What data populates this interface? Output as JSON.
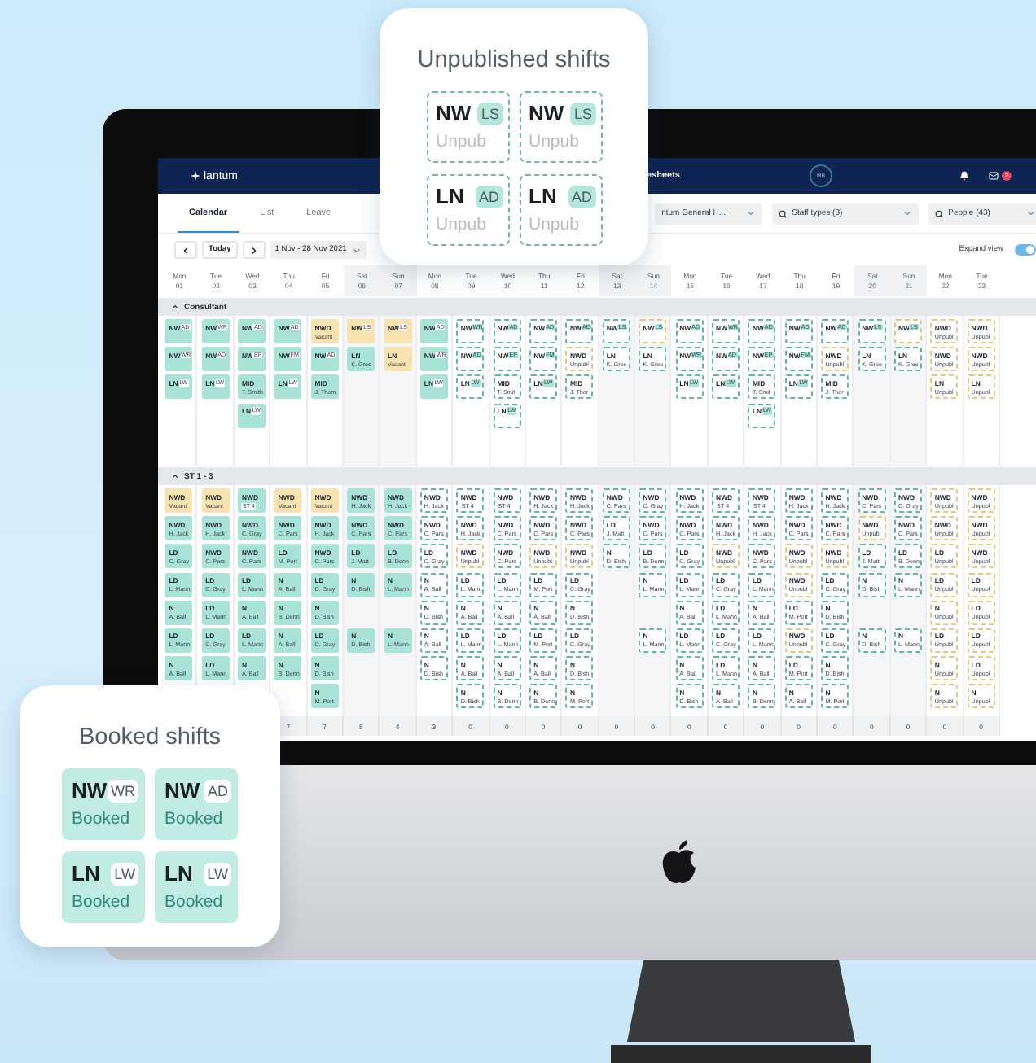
{
  "cards": [
    {
      "title": "Unpublished shifts",
      "shifts": [
        {
          "code": "NW",
          "tag": "LS",
          "status": "Unpub",
          "kind": "unpublished"
        },
        {
          "code": "NW",
          "tag": "LS",
          "status": "Unpub",
          "kind": "unpublished"
        },
        {
          "code": "LN",
          "tag": "AD",
          "status": "Unpub",
          "kind": "unpublished"
        },
        {
          "code": "LN",
          "tag": "AD",
          "status": "Unpub",
          "kind": "unpublished"
        }
      ]
    },
    {
      "title": "Booked shifts",
      "shifts": [
        {
          "code": "NW",
          "tag": "WR",
          "status": "Booked",
          "kind": "booked"
        },
        {
          "code": "NW",
          "tag": "AD",
          "status": "Booked",
          "kind": "booked"
        },
        {
          "code": "LN",
          "tag": "LW",
          "status": "Booked",
          "kind": "booked"
        },
        {
          "code": "LN",
          "tag": "LW",
          "status": "Booked",
          "kind": "booked"
        }
      ]
    }
  ],
  "app": {
    "logo": "lantum",
    "nav": [
      {
        "label": "esheets"
      }
    ],
    "avatar": "MB",
    "mail_count": "2",
    "tabs": [
      {
        "label": "Calendar",
        "selected": true
      },
      {
        "label": "List",
        "selected": false
      },
      {
        "label": "Leave",
        "selected": false
      }
    ],
    "filters": [
      {
        "label": "ntum General H...",
        "search": false
      },
      {
        "label": "Staff types (3)",
        "search": true
      },
      {
        "label": "People (43)",
        "search": true
      }
    ],
    "today": "Today",
    "date_range": "1 Nov - 28 Nov 2021",
    "expand_view": {
      "label": "Expand view",
      "on": true
    }
  },
  "days": [
    {
      "day": "Mon",
      "date": "01",
      "weekend": false
    },
    {
      "day": "Tue",
      "date": "02",
      "weekend": false
    },
    {
      "day": "Wed",
      "date": "03",
      "weekend": false
    },
    {
      "day": "Thu",
      "date": "04",
      "weekend": false
    },
    {
      "day": "Fri",
      "date": "05",
      "weekend": false
    },
    {
      "day": "Sat",
      "date": "06",
      "weekend": true
    },
    {
      "day": "Sun",
      "date": "07",
      "weekend": true
    },
    {
      "day": "Mon",
      "date": "08",
      "weekend": false
    },
    {
      "day": "Tue",
      "date": "09",
      "weekend": false
    },
    {
      "day": "Wed",
      "date": "10",
      "weekend": false
    },
    {
      "day": "Thu",
      "date": "11",
      "weekend": false
    },
    {
      "day": "Fri",
      "date": "12",
      "weekend": false
    },
    {
      "day": "Sat",
      "date": "13",
      "weekend": true
    },
    {
      "day": "Sun",
      "date": "14",
      "weekend": true
    },
    {
      "day": "Mon",
      "date": "15",
      "weekend": false
    },
    {
      "day": "Tue",
      "date": "16",
      "weekend": false
    },
    {
      "day": "Wed",
      "date": "17",
      "weekend": false
    },
    {
      "day": "Thu",
      "date": "18",
      "weekend": false
    },
    {
      "day": "Fri",
      "date": "19",
      "weekend": false
    },
    {
      "day": "Sat",
      "date": "20",
      "weekend": true
    },
    {
      "day": "Sun",
      "date": "21",
      "weekend": true
    },
    {
      "day": "Mon",
      "date": "22",
      "weekend": false
    },
    {
      "day": "Tue",
      "date": "23",
      "weekend": false
    }
  ],
  "sections": [
    {
      "title": "Consultant",
      "expanded": true,
      "columns": [
        [
          {
            "code": "NW",
            "tag": "AD",
            "kind": "booked"
          },
          {
            "code": "NW",
            "tag": "WR",
            "kind": "booked"
          },
          {
            "code": "LN",
            "tag": "LW",
            "kind": "booked"
          }
        ],
        [
          {
            "code": "NW",
            "tag": "WR",
            "kind": "booked"
          },
          {
            "code": "NW",
            "tag": "AD",
            "kind": "booked"
          },
          {
            "code": "LN",
            "tag": "LW",
            "kind": "booked"
          }
        ],
        [
          {
            "code": "NW",
            "tag": "AD",
            "kind": "booked"
          },
          {
            "code": "NW",
            "tag": "EP",
            "kind": "booked"
          },
          {
            "code": "MID",
            "name": "T. Smith",
            "kind": "booked"
          },
          {
            "code": "LN",
            "tag": "LW",
            "kind": "booked"
          }
        ],
        [
          {
            "code": "NW",
            "tag": "AD",
            "kind": "booked"
          },
          {
            "code": "NW",
            "tag": "FM",
            "kind": "booked"
          },
          {
            "code": "LN",
            "tag": "LW",
            "kind": "booked"
          }
        ],
        [
          {
            "code": "NWD",
            "name": "Vacant",
            "kind": "vacant"
          },
          {
            "code": "NW",
            "tag": "AD",
            "kind": "booked"
          },
          {
            "code": "MID",
            "name": "J. Thom",
            "kind": "booked"
          }
        ],
        [
          {
            "code": "NW",
            "tag": "LS",
            "kind": "vacant"
          },
          {
            "code": "LN",
            "name": "K. Gree",
            "kind": "booked"
          }
        ],
        [
          {
            "code": "NW",
            "tag": "LS",
            "kind": "vacant"
          },
          {
            "code": "LN",
            "name": "Vacant",
            "kind": "vacant"
          }
        ],
        [
          {
            "code": "NW",
            "tag": "AD",
            "kind": "booked"
          },
          {
            "code": "NW",
            "tag": "WR",
            "kind": "booked"
          },
          {
            "code": "LN",
            "tag": "LW",
            "kind": "booked"
          }
        ],
        [
          {
            "code": "NW",
            "tag": "WR",
            "kind": "unpublished"
          },
          {
            "code": "NW",
            "tag": "AD",
            "kind": "unpublished"
          },
          {
            "code": "LN",
            "tag": "LW",
            "kind": "unpublished"
          }
        ],
        [
          {
            "code": "NW",
            "tag": "AD",
            "kind": "unpublished"
          },
          {
            "code": "NW",
            "tag": "EP",
            "kind": "unpublished"
          },
          {
            "code": "MID",
            "name": "T. Smit",
            "kind": "unpublished"
          },
          {
            "code": "LN",
            "tag": "LW",
            "kind": "unpublished"
          }
        ],
        [
          {
            "code": "NW",
            "tag": "AD",
            "kind": "unpublished"
          },
          {
            "code": "NW",
            "tag": "FM",
            "kind": "unpublished"
          },
          {
            "code": "LN",
            "tag": "LW",
            "kind": "unpublished"
          }
        ],
        [
          {
            "code": "NW",
            "tag": "AD",
            "kind": "unpublished"
          },
          {
            "code": "NWD",
            "name": "Unpubl",
            "kind": "open"
          },
          {
            "code": "MID",
            "name": "J. Thor",
            "kind": "unpublished"
          }
        ],
        [
          {
            "code": "NW",
            "tag": "LS",
            "kind": "unpublished"
          },
          {
            "code": "LN",
            "name": "K. Gree",
            "kind": "unpublished"
          }
        ],
        [
          {
            "code": "NW",
            "tag": "LS",
            "kind": "open"
          },
          {
            "code": "LN",
            "name": "K. Gree",
            "kind": "unpublished"
          }
        ],
        [
          {
            "code": "NW",
            "tag": "AD",
            "kind": "unpublished"
          },
          {
            "code": "NW",
            "tag": "WR",
            "kind": "unpublished"
          },
          {
            "code": "LN",
            "tag": "LW",
            "kind": "unpublished"
          }
        ],
        [
          {
            "code": "NW",
            "tag": "WR",
            "kind": "unpublished"
          },
          {
            "code": "NW",
            "tag": "AD",
            "kind": "unpublished"
          },
          {
            "code": "LN",
            "tag": "LW",
            "kind": "unpublished"
          }
        ],
        [
          {
            "code": "NW",
            "tag": "AD",
            "kind": "unpublished"
          },
          {
            "code": "NW",
            "tag": "EP",
            "kind": "unpublished"
          },
          {
            "code": "MID",
            "name": "T. Smit",
            "kind": "unpublished"
          },
          {
            "code": "LN",
            "tag": "LW",
            "kind": "unpublished"
          }
        ],
        [
          {
            "code": "NW",
            "tag": "AD",
            "kind": "unpublished"
          },
          {
            "code": "NW",
            "tag": "FM",
            "kind": "unpublished"
          },
          {
            "code": "LN",
            "tag": "LW",
            "kind": "unpublished"
          }
        ],
        [
          {
            "code": "NW",
            "tag": "AD",
            "kind": "unpublished"
          },
          {
            "code": "NWD",
            "name": "Unpubl",
            "kind": "open"
          },
          {
            "code": "MID",
            "name": "J. Thor",
            "kind": "unpublished"
          }
        ],
        [
          {
            "code": "NW",
            "tag": "LS",
            "kind": "unpublished"
          },
          {
            "code": "LN",
            "name": "K. Gree",
            "kind": "unpublished"
          }
        ],
        [
          {
            "code": "NW",
            "tag": "LS",
            "kind": "open"
          },
          {
            "code": "LN",
            "name": "K. Gree",
            "kind": "unpublished"
          }
        ],
        [
          {
            "code": "NWD",
            "name": "Unpubl",
            "kind": "open"
          },
          {
            "code": "NWD",
            "name": "Unpubl",
            "kind": "open"
          },
          {
            "code": "LN",
            "name": "Unpubl",
            "kind": "open"
          }
        ],
        [
          {
            "code": "NWD",
            "name": "Unpubl",
            "kind": "open"
          },
          {
            "code": "NWD",
            "name": "Unpubl",
            "kind": "open"
          },
          {
            "code": "LN",
            "name": "Unpubl",
            "kind": "open"
          }
        ]
      ]
    },
    {
      "title": "ST 1 - 3",
      "expanded": true,
      "counts": [
        "7",
        "7",
        "5",
        "4",
        "3",
        "0",
        "0",
        "0",
        "0",
        "0",
        "0",
        "0",
        "0",
        "0",
        "0",
        "0",
        "0",
        "0",
        "0",
        "0"
      ],
      "columns": [
        [
          {
            "code": "NWD",
            "name": "Vacant",
            "kind": "vacant"
          },
          {
            "code": "NWD",
            "name": "H. Jack",
            "kind": "booked"
          },
          {
            "code": "LD",
            "name": "C. Gray",
            "kind": "booked"
          },
          {
            "code": "LD",
            "name": "L. Mann",
            "kind": "booked"
          },
          {
            "code": "N",
            "name": "A. Ball",
            "kind": "booked"
          },
          {
            "code": "LD",
            "name": "L. Mann",
            "kind": "booked"
          },
          {
            "code": "N",
            "name": "A. Ball",
            "kind": "booked"
          }
        ],
        [
          {
            "code": "NWD",
            "name": "Vacant",
            "kind": "vacant"
          },
          {
            "code": "NWD",
            "name": "H. Jack",
            "kind": "booked"
          },
          {
            "code": "NWD",
            "name": "C. Pars",
            "kind": "booked"
          },
          {
            "code": "LD",
            "name": "C. Gray",
            "kind": "booked"
          },
          {
            "code": "LD",
            "name": "L. Mann",
            "kind": "booked"
          },
          {
            "code": "LD",
            "name": "C. Gray",
            "kind": "booked"
          },
          {
            "code": "LD",
            "name": "L. Mann",
            "kind": "booked"
          }
        ],
        [
          {
            "code": "NWD",
            "badge": "ST 4",
            "kind": "booked"
          },
          {
            "code": "NWD",
            "name": "C. Gray",
            "kind": "booked"
          },
          {
            "code": "NWD",
            "name": "C. Pars",
            "kind": "booked"
          },
          {
            "code": "LD",
            "name": "L. Mann",
            "kind": "booked"
          },
          {
            "code": "N",
            "name": "A. Ball",
            "kind": "booked"
          },
          {
            "code": "LD",
            "name": "L. Mann",
            "kind": "booked"
          },
          {
            "code": "N",
            "name": "A. Ball",
            "kind": "booked"
          }
        ],
        [
          {
            "code": "NWD",
            "name": "Vacant",
            "kind": "vacant"
          },
          {
            "code": "NWD",
            "name": "C. Pars",
            "kind": "booked"
          },
          {
            "code": "LD",
            "name": "M. Port",
            "kind": "booked"
          },
          {
            "code": "N",
            "name": "A. Ball",
            "kind": "booked"
          },
          {
            "code": "N",
            "name": "B. Denn",
            "kind": "booked"
          },
          {
            "code": "N",
            "name": "A. Ball",
            "kind": "booked"
          },
          {
            "code": "N",
            "name": "B. Denn",
            "kind": "booked"
          }
        ],
        [
          {
            "code": "NWD",
            "name": "Vacant",
            "kind": "vacant"
          },
          {
            "code": "NWD",
            "name": "H. Jack",
            "kind": "booked"
          },
          {
            "code": "NWD",
            "name": "C. Pars",
            "kind": "booked"
          },
          {
            "code": "LD",
            "name": "C. Gray",
            "kind": "booked"
          },
          {
            "code": "N",
            "name": "D. Bish",
            "kind": "booked"
          },
          {
            "code": "LD",
            "name": "C. Gray",
            "kind": "booked"
          },
          {
            "code": "N",
            "name": "D. Bish",
            "kind": "booked"
          },
          {
            "code": "N",
            "name": "M. Port",
            "kind": "booked"
          }
        ],
        [
          {
            "code": "NWD",
            "name": "H. Jack",
            "kind": "booked"
          },
          {
            "code": "NWD",
            "name": "C. Pars",
            "kind": "booked"
          },
          {
            "code": "LD",
            "name": "J. Matt",
            "kind": "booked"
          },
          {
            "code": "N",
            "name": "D. Bish",
            "kind": "booked"
          },
          {
            "kind": "empty"
          },
          {
            "code": "N",
            "name": "D. Bish",
            "kind": "booked"
          }
        ],
        [
          {
            "code": "NWD",
            "name": "H. Jack",
            "kind": "booked"
          },
          {
            "code": "NWD",
            "name": "C. Pars",
            "kind": "booked"
          },
          {
            "code": "LD",
            "name": "B. Denn",
            "kind": "booked"
          },
          {
            "code": "N",
            "name": "L. Mann",
            "kind": "booked"
          },
          {
            "kind": "empty"
          },
          {
            "code": "N",
            "name": "L. Mann",
            "kind": "booked"
          }
        ],
        [
          {
            "code": "NWD",
            "name": "H. Jack",
            "kind": "unpublished"
          },
          {
            "code": "NWD",
            "name": "C. Pars",
            "kind": "unpublished"
          },
          {
            "code": "LD",
            "name": "C. Gray",
            "kind": "unpublished"
          },
          {
            "code": "N",
            "name": "A. Ball",
            "kind": "unpublished"
          },
          {
            "code": "N",
            "name": "D. Bish",
            "kind": "unpublished"
          },
          {
            "code": "N",
            "name": "A. Ball",
            "kind": "unpublished"
          },
          {
            "code": "N",
            "name": "D. Bish",
            "kind": "unpublished"
          }
        ],
        [
          {
            "code": "NWD",
            "badge": "ST 4",
            "kind": "unpublished"
          },
          {
            "code": "NWD",
            "name": "H. Jack",
            "kind": "unpublished"
          },
          {
            "code": "NWD",
            "name": "Unpubl",
            "kind": "open"
          },
          {
            "code": "LD",
            "name": "L. Mann",
            "kind": "unpublished"
          },
          {
            "code": "N",
            "name": "A. Ball",
            "kind": "unpublished"
          },
          {
            "code": "LD",
            "name": "L. Mann",
            "kind": "unpublished"
          },
          {
            "code": "N",
            "name": "A. Ball",
            "kind": "unpublished"
          },
          {
            "code": "N",
            "name": "D. Bish",
            "kind": "unpublished"
          }
        ],
        [
          {
            "code": "NWD",
            "badge": "ST 4",
            "kind": "unpublished"
          },
          {
            "code": "NWD",
            "name": "C. Pars",
            "kind": "unpublished"
          },
          {
            "code": "NWD",
            "name": "C. Pars",
            "kind": "unpublished"
          },
          {
            "code": "LD",
            "name": "L. Mann",
            "kind": "unpublished"
          },
          {
            "code": "N",
            "name": "A. Ball",
            "kind": "unpublished"
          },
          {
            "code": "LD",
            "name": "L. Mann",
            "kind": "unpublished"
          },
          {
            "code": "N",
            "name": "A. Ball",
            "kind": "unpublished"
          },
          {
            "code": "N",
            "name": "B. Denn",
            "kind": "unpublished"
          }
        ],
        [
          {
            "code": "NWD",
            "name": "H. Jack",
            "kind": "unpublished"
          },
          {
            "code": "NWD",
            "name": "C. Pars",
            "kind": "unpublished"
          },
          {
            "code": "NWD",
            "name": "Unpubl",
            "kind": "open"
          },
          {
            "code": "LD",
            "name": "M. Port",
            "kind": "unpublished"
          },
          {
            "code": "N",
            "name": "A. Ball",
            "kind": "unpublished"
          },
          {
            "code": "LD",
            "name": "M. Port",
            "kind": "unpublished"
          },
          {
            "code": "N",
            "name": "A. Ball",
            "kind": "unpublished"
          },
          {
            "code": "N",
            "name": "B. Denn",
            "kind": "unpublished"
          }
        ],
        [
          {
            "code": "NWD",
            "name": "H. Jack",
            "kind": "unpublished"
          },
          {
            "code": "NWD",
            "name": "C. Pars",
            "kind": "unpublished"
          },
          {
            "code": "NWD",
            "name": "Unpubl",
            "kind": "open"
          },
          {
            "code": "LD",
            "name": "C. Gray",
            "kind": "unpublished"
          },
          {
            "code": "N",
            "name": "D. Bish",
            "kind": "unpublished"
          },
          {
            "code": "LD",
            "name": "C. Gray",
            "kind": "unpublished"
          },
          {
            "code": "N",
            "name": "D. Bish",
            "kind": "unpublished"
          },
          {
            "code": "N",
            "name": "M. Port",
            "kind": "unpublished"
          }
        ],
        [
          {
            "code": "NWD",
            "name": "C. Pars",
            "kind": "unpublished"
          },
          {
            "code": "LD",
            "name": "J. Matt",
            "kind": "unpublished"
          },
          {
            "code": "N",
            "name": "D. Bish",
            "kind": "unpublished"
          }
        ],
        [
          {
            "code": "NWD",
            "name": "C. Gray",
            "kind": "unpublished"
          },
          {
            "code": "NWD",
            "name": "C. Pars",
            "kind": "unpublished"
          },
          {
            "code": "LD",
            "name": "B. Denn",
            "kind": "unpublished"
          },
          {
            "code": "N",
            "name": "L. Mann",
            "kind": "unpublished"
          },
          {
            "kind": "empty"
          },
          {
            "code": "N",
            "name": "L. Mann",
            "kind": "unpublished"
          }
        ],
        [
          {
            "code": "NWD",
            "name": "H. Jack",
            "kind": "unpublished"
          },
          {
            "code": "NWD",
            "name": "C. Pars",
            "kind": "unpublished"
          },
          {
            "code": "LD",
            "name": "C. Gray",
            "kind": "unpublished"
          },
          {
            "code": "LD",
            "name": "L. Mann",
            "kind": "unpublished"
          },
          {
            "code": "N",
            "name": "A. Ball",
            "kind": "unpublished"
          },
          {
            "code": "LD",
            "name": "L. Mann",
            "kind": "unpublished"
          },
          {
            "code": "N",
            "name": "A. Ball",
            "kind": "unpublished"
          },
          {
            "code": "N",
            "name": "D. Bish",
            "kind": "unpublished"
          }
        ],
        [
          {
            "code": "NWD",
            "badge": "ST 4",
            "kind": "unpublished"
          },
          {
            "code": "NWD",
            "name": "H. Jack",
            "kind": "unpublished"
          },
          {
            "code": "NWD",
            "name": "Unpubl",
            "kind": "open"
          },
          {
            "code": "LD",
            "name": "C. Gray",
            "kind": "unpublished"
          },
          {
            "code": "LD",
            "name": "L. Mann",
            "kind": "unpublished"
          },
          {
            "code": "LD",
            "name": "C. Gray",
            "kind": "unpublished"
          },
          {
            "code": "LD",
            "name": "L. Mann",
            "kind": "unpublished"
          },
          {
            "code": "N",
            "name": "A. Ball",
            "kind": "unpublished"
          }
        ],
        [
          {
            "code": "NWD",
            "badge": "ST 4",
            "kind": "unpublished"
          },
          {
            "code": "NWD",
            "name": "H. Jack",
            "kind": "unpublished"
          },
          {
            "code": "NWD",
            "name": "C. Pars",
            "kind": "unpublished"
          },
          {
            "code": "LD",
            "name": "L. Mann",
            "kind": "unpublished"
          },
          {
            "code": "N",
            "name": "A. Ball",
            "kind": "unpublished"
          },
          {
            "code": "LD",
            "name": "L. Mann",
            "kind": "unpublished"
          },
          {
            "code": "N",
            "name": "A. Ball",
            "kind": "unpublished"
          },
          {
            "code": "N",
            "name": "B. Denn",
            "kind": "unpublished"
          }
        ],
        [
          {
            "code": "NWD",
            "name": "H. Jack",
            "kind": "unpublished"
          },
          {
            "code": "NWD",
            "name": "C. Pars",
            "kind": "unpublished"
          },
          {
            "code": "NWD",
            "name": "Unpubl",
            "kind": "open"
          },
          {
            "code": "NWD",
            "name": "Unpubl",
            "kind": "open"
          },
          {
            "code": "LD",
            "name": "M. Port",
            "kind": "unpublished"
          },
          {
            "code": "NWD",
            "name": "Unpubl",
            "kind": "open"
          },
          {
            "code": "LD",
            "name": "M. Port",
            "kind": "unpublished"
          },
          {
            "code": "N",
            "name": "A. Ball",
            "kind": "unpublished"
          }
        ],
        [
          {
            "code": "NWD",
            "name": "H. Jack",
            "kind": "unpublished"
          },
          {
            "code": "NWD",
            "name": "C. Pars",
            "kind": "unpublished"
          },
          {
            "code": "NWD",
            "name": "Unpubl",
            "kind": "open"
          },
          {
            "code": "LD",
            "name": "C. Gray",
            "kind": "unpublished"
          },
          {
            "code": "N",
            "name": "D. Bish",
            "kind": "unpublished"
          },
          {
            "code": "LD",
            "name": "C. Gray",
            "kind": "unpublished"
          },
          {
            "code": "N",
            "name": "D. Bish",
            "kind": "unpublished"
          },
          {
            "code": "N",
            "name": "M. Port",
            "kind": "unpublished"
          }
        ],
        [
          {
            "code": "NWD",
            "name": "C. Pars",
            "kind": "unpublished"
          },
          {
            "code": "NWD",
            "name": "Unpubl",
            "kind": "open"
          },
          {
            "code": "LD",
            "name": "J. Matt",
            "kind": "unpublished"
          },
          {
            "code": "N",
            "name": "D. Bish",
            "kind": "unpublished"
          },
          {
            "kind": "empty"
          },
          {
            "code": "N",
            "name": "D. Bish",
            "kind": "unpublished"
          }
        ],
        [
          {
            "code": "NWD",
            "name": "C. Gray",
            "kind": "unpublished"
          },
          {
            "code": "NWD",
            "name": "C. Pars",
            "kind": "unpublished"
          },
          {
            "code": "LD",
            "name": "B. Denn",
            "kind": "unpublished"
          },
          {
            "code": "N",
            "name": "L. Mann",
            "kind": "unpublished"
          },
          {
            "kind": "empty"
          },
          {
            "code": "N",
            "name": "L. Mann",
            "kind": "unpublished"
          }
        ],
        [
          {
            "code": "NWD",
            "name": "Unpubl",
            "kind": "open"
          },
          {
            "code": "NWD",
            "name": "Unpubl",
            "kind": "open"
          },
          {
            "code": "LD",
            "name": "Unpubl",
            "kind": "open"
          },
          {
            "code": "LD",
            "name": "Unpubl",
            "kind": "open"
          },
          {
            "code": "N",
            "name": "Unpubl",
            "kind": "open"
          },
          {
            "code": "LD",
            "name": "Unpubl",
            "kind": "open"
          },
          {
            "code": "N",
            "name": "Unpubl",
            "kind": "open"
          },
          {
            "code": "N",
            "name": "Unpubl",
            "kind": "open"
          }
        ],
        [
          {
            "code": "NWD",
            "name": "Unpubl",
            "kind": "open"
          },
          {
            "code": "NWD",
            "name": "Unpubl",
            "kind": "open"
          },
          {
            "code": "NWD",
            "name": "Unpubl",
            "kind": "open"
          },
          {
            "code": "LD",
            "name": "Unpubl",
            "kind": "open"
          },
          {
            "code": "LD",
            "name": "Unpubl",
            "kind": "open"
          },
          {
            "code": "LD",
            "name": "Unpubl",
            "kind": "open"
          },
          {
            "code": "LD",
            "name": "Unpubl",
            "kind": "open"
          },
          {
            "code": "N",
            "name": "Unpubl",
            "kind": "open"
          }
        ]
      ]
    }
  ]
}
